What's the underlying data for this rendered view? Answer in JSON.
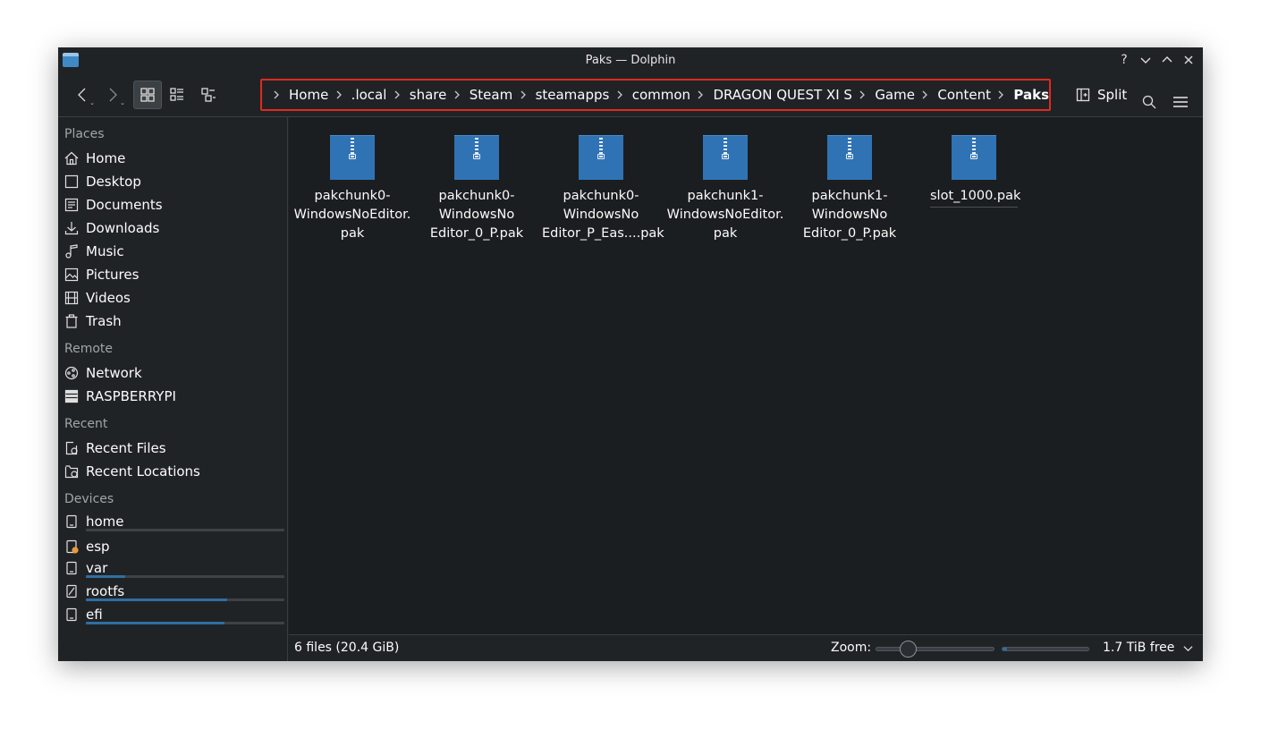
{
  "window": {
    "title": "Paks — Dolphin"
  },
  "toolbar": {
    "breadcrumb": [
      "Home",
      ".local",
      "share",
      "Steam",
      "steamapps",
      "common",
      "DRAGON QUEST XI S",
      "Game",
      "Content",
      "Paks"
    ],
    "split_label": "Split"
  },
  "sidebar": {
    "places_header": "Places",
    "places": [
      "Home",
      "Desktop",
      "Documents",
      "Downloads",
      "Music",
      "Pictures",
      "Videos",
      "Trash"
    ],
    "remote_header": "Remote",
    "remote": [
      "Network",
      "RASPBERRYPI"
    ],
    "recent_header": "Recent",
    "recent": [
      "Recent Files",
      "Recent Locations"
    ],
    "devices_header": "Devices",
    "devices": [
      {
        "name": "home",
        "usage": 0.0
      },
      {
        "name": "esp",
        "usage": null
      },
      {
        "name": "var",
        "usage": 0.2
      },
      {
        "name": "rootfs",
        "usage": 0.71
      },
      {
        "name": "efi",
        "usage": 0.7
      }
    ]
  },
  "files": [
    {
      "name": "pakchunk0-\nWindowsNoEditor.\npak"
    },
    {
      "name": "pakchunk0-\nWindowsNo\nEditor_0_P.pak"
    },
    {
      "name": "pakchunk0-\nWindowsNo\nEditor_P_Eas....pak"
    },
    {
      "name": "pakchunk1-\nWindowsNoEditor.\npak"
    },
    {
      "name": "pakchunk1-\nWindowsNo\nEditor_0_P.pak"
    },
    {
      "name": "slot_1000.pak"
    }
  ],
  "statusbar": {
    "summary": "6 files (20.4 GiB)",
    "zoom_label": "Zoom:",
    "zoom_level": 0.28,
    "space_used": 0.05,
    "free_space": "1.7 TiB free"
  }
}
